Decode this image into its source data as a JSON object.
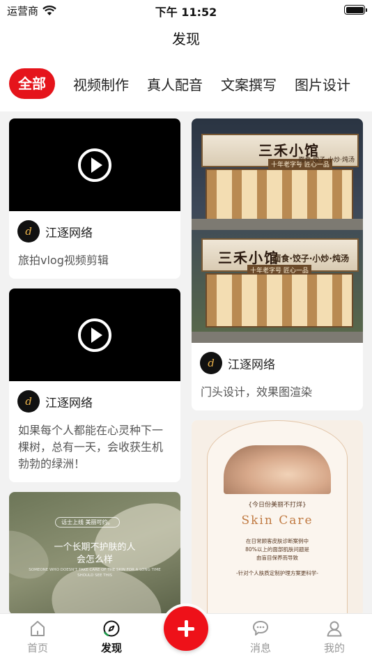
{
  "status_bar": {
    "carrier": "运营商",
    "time": "下午 11:52"
  },
  "header": {
    "title": "发现"
  },
  "tabs": [
    {
      "label": "全部",
      "active": true
    },
    {
      "label": "视频制作"
    },
    {
      "label": "真人配音"
    },
    {
      "label": "文案撰写"
    },
    {
      "label": "图片设计"
    }
  ],
  "feed": {
    "left": [
      {
        "type": "video",
        "author": "江逐网络",
        "description": "旅拍vlog视频剪辑"
      },
      {
        "type": "video",
        "author": "江逐网络",
        "description": "如果每个人都能在心灵种下一棵树，总有一天，会收获生机勃勃的绿洲！"
      },
      {
        "type": "image",
        "pill": "话士上线 美丽可约。",
        "line1": "一个长期不护肤的人",
        "line2": "会怎么样",
        "line3": "SOMEONE WHO DOESN'T TAKE CARE OF THE SKIN FOR A LONG TIME SHOULD SEE THIS"
      }
    ],
    "right": [
      {
        "type": "image",
        "sign_top": "三禾小馆",
        "sign_bottom": "三禾小馆",
        "sub": "十年老字号 匠心一品",
        "side_top": "面食·饺子·小炒·炖汤",
        "side_bottom": "面食·饺子·小炒·炖汤",
        "author": "江逐网络",
        "description": "门头设计，效果图渲染"
      },
      {
        "type": "image",
        "tag": "{今日份美丽不打烊}",
        "title": "Skin Care",
        "lines": [
          "在日常顾客皮肤诊断案例中",
          "80%以上的面部肌肤问题是",
          "由盲目保养而导致",
          "",
          "-针对个人肤质定制护理方案更科学-"
        ]
      }
    ]
  },
  "bottom_nav": [
    {
      "label": "首页",
      "icon": "home-icon"
    },
    {
      "label": "发现",
      "icon": "compass-icon",
      "active": true
    },
    {
      "label": "消息",
      "icon": "chat-icon"
    },
    {
      "label": "我的",
      "icon": "user-icon"
    }
  ],
  "colors": {
    "accent": "#e5141b"
  }
}
